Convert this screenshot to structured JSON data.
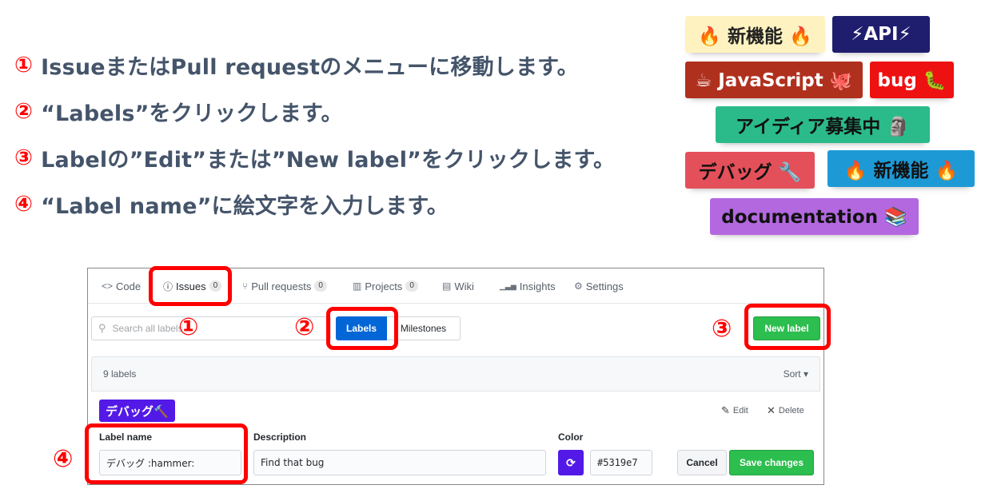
{
  "steps": [
    {
      "num": "①",
      "text": "IssueまたはPull requestのメニューに移動します。"
    },
    {
      "num": "②",
      "text": "“Labels”をクリックします。"
    },
    {
      "num": "③",
      "text": "Labelの”Edit”または”New label”をクリックします。"
    },
    {
      "num": "④",
      "text": "“Label name”に絵文字を入力します。"
    }
  ],
  "badges": [
    {
      "text": "🔥 新機能 🔥",
      "bg": "#fef2c0",
      "fg": "#222222"
    },
    {
      "text": "⚡API⚡",
      "bg": "#1f1e6e",
      "fg": "#ffffff"
    },
    {
      "text": "☕ JavaScript 🐙",
      "bg": "#b0301e",
      "fg": "#ffffff"
    },
    {
      "text": "bug 🐛",
      "bg": "#ee1111",
      "fg": "#ffffff"
    },
    {
      "text": "アイディア募集中 🗿",
      "bg": "#2bbb8a",
      "fg": "#111111"
    },
    {
      "text": "デバッグ 🔧",
      "bg": "#e4505a",
      "fg": "#111111"
    },
    {
      "text": "🔥 新機能 🔥",
      "bg": "#1d9ad6",
      "fg": "#111111"
    },
    {
      "text": "documentation 📚",
      "bg": "#b368e0",
      "fg": "#111111"
    }
  ],
  "tabs": {
    "code": {
      "icon": "<>",
      "label": "Code"
    },
    "issues": {
      "icon": "ⓘ",
      "label": "Issues",
      "count": "0"
    },
    "pulls": {
      "icon": "⑂",
      "label": "Pull requests",
      "count": "0"
    },
    "projects": {
      "icon": "▥",
      "label": "Projects",
      "count": "0"
    },
    "wiki": {
      "icon": "▤",
      "label": "Wiki"
    },
    "insights": {
      "icon": "▁▃▅",
      "label": "Insights"
    },
    "settings": {
      "icon": "⚙",
      "label": "Settings"
    }
  },
  "toolbar": {
    "search_placeholder": "Search all labels",
    "labels_button": "Labels",
    "milestones_button": "Milestones",
    "new_label_button": "New label"
  },
  "list": {
    "count_text": "9 labels",
    "sort_text": "Sort ▾"
  },
  "label_row": {
    "chip_text": "デバッグ🔨",
    "chip_color": "#5319e7",
    "edit_text": "Edit",
    "delete_text": "Delete"
  },
  "form": {
    "name_label": "Label name",
    "name_value": "デバッグ :hammer:",
    "description_label": "Description",
    "description_value": "Find that bug",
    "color_label": "Color",
    "color_value": "#5319e7",
    "cancel_button": "Cancel",
    "save_button": "Save changes"
  },
  "callout_numbers": [
    "①",
    "②",
    "③",
    "④"
  ]
}
